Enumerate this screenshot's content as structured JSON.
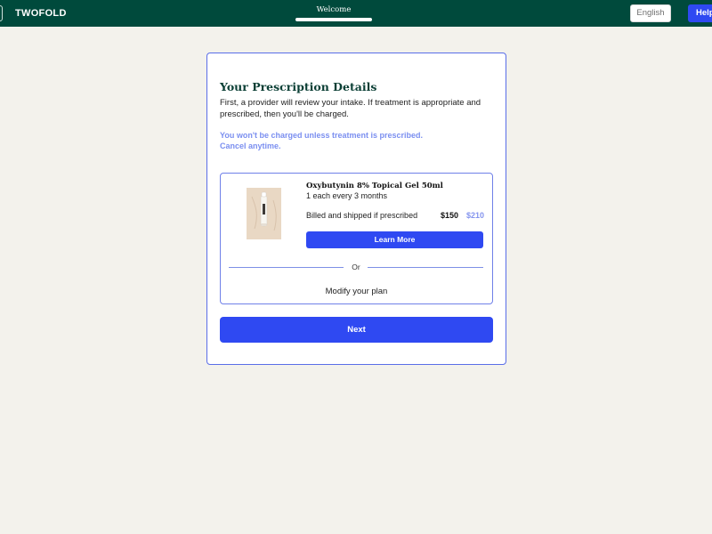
{
  "header": {
    "logo": "TWOFOLD",
    "step_title": "Welcome",
    "progress": 1.0,
    "language_button": "English",
    "help_button": "Help"
  },
  "card": {
    "title": "Your Prescription Details",
    "description": "First, a provider will review your intake. If treatment is appropriate and prescribed, then you'll be charged.",
    "note_line1": "You won't be charged unless treatment is prescribed.",
    "note_line2": "Cancel anytime.",
    "product": {
      "name": "Oxybutynin 8% Topical Gel 50ml",
      "frequency": "1 each every 3 months",
      "billing": "Billed and shipped if prescribed",
      "price": "$150",
      "original_price": "$210",
      "learn_more": "Learn More",
      "or_label": "Or",
      "modify_label": "Modify your plan"
    },
    "next_button": "Next"
  },
  "colors": {
    "header_bg": "#004a3c",
    "accent": "#2f49f2",
    "page_bg": "#f3f2ec",
    "note_text": "#7b8ff0"
  },
  "icons": {
    "product_image": "gel-tube-photo"
  }
}
